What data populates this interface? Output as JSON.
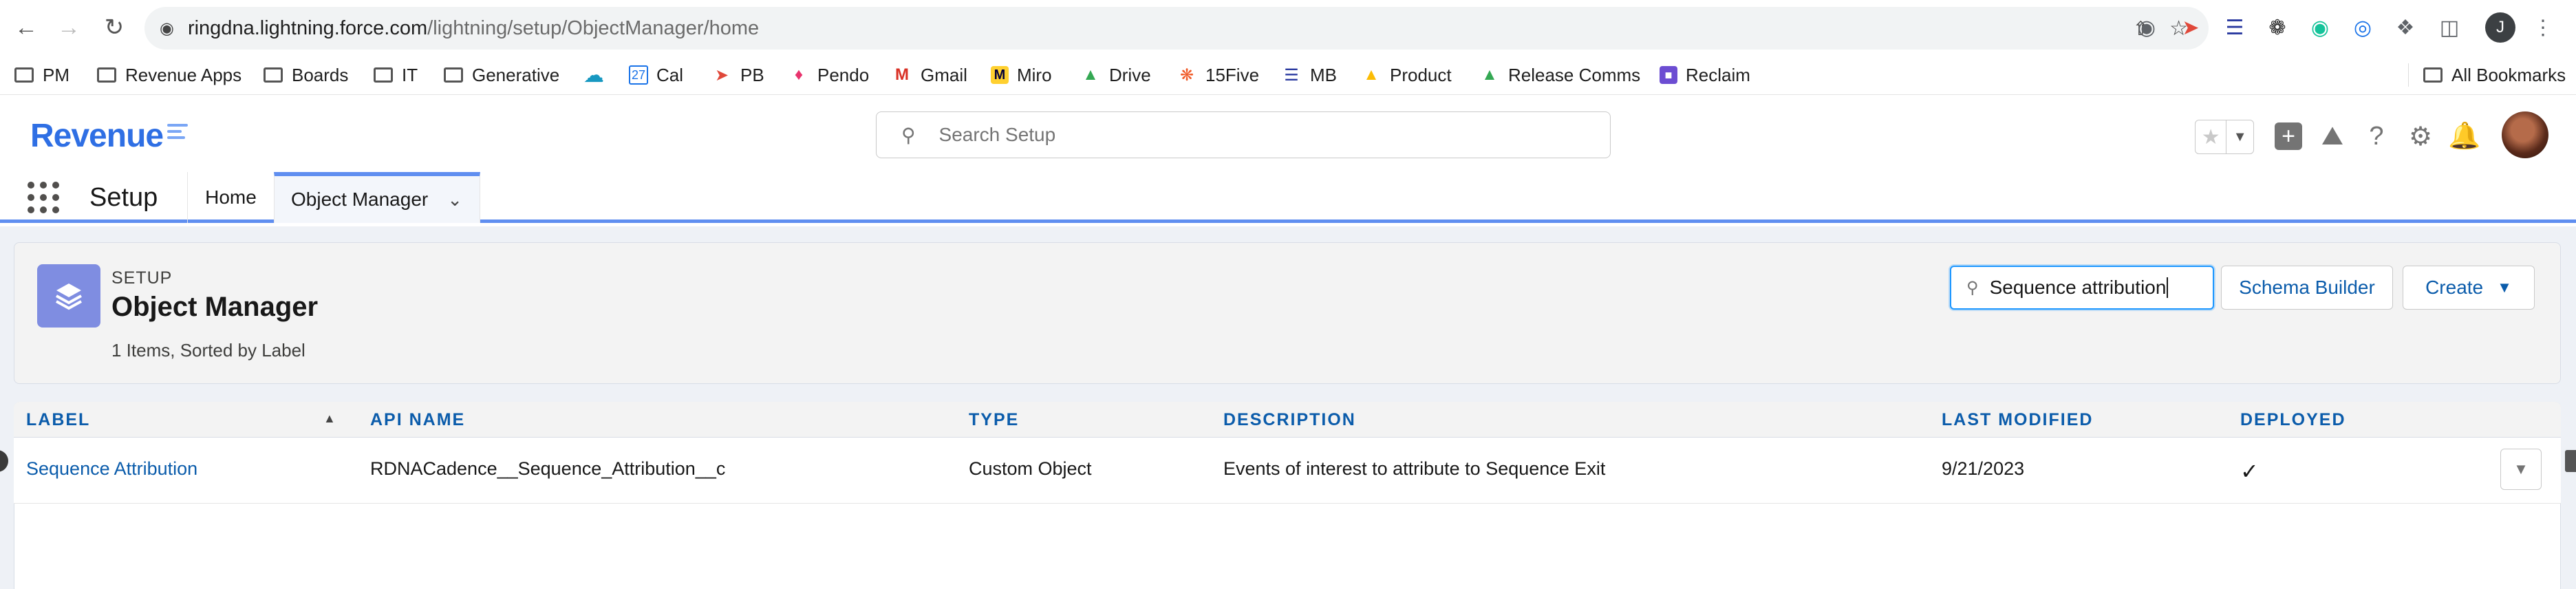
{
  "browser": {
    "url_host": "ringdna.lightning.force.com",
    "url_path": "/lightning/setup/ObjectManager/home",
    "bookmarks": [
      {
        "label": "PM",
        "icon": "folder-icon"
      },
      {
        "label": "Revenue Apps",
        "icon": "folder-icon"
      },
      {
        "label": "Boards",
        "icon": "folder-icon"
      },
      {
        "label": "IT",
        "icon": "folder-icon"
      },
      {
        "label": "Generative",
        "icon": "folder-icon"
      },
      {
        "label": "",
        "icon": "salesforce-cloud-icon"
      },
      {
        "label": "Cal",
        "icon": "calendar-icon"
      },
      {
        "label": "PB",
        "icon": "pb-icon"
      },
      {
        "label": "Pendo",
        "icon": "pendo-icon"
      },
      {
        "label": "Gmail",
        "icon": "gmail-icon"
      },
      {
        "label": "Miro",
        "icon": "miro-icon"
      },
      {
        "label": "Drive",
        "icon": "drive-icon"
      },
      {
        "label": "15Five",
        "icon": "15five-icon"
      },
      {
        "label": "MB",
        "icon": "mb-icon"
      },
      {
        "label": "Product",
        "icon": "drive-icon"
      },
      {
        "label": "Release Comms",
        "icon": "drive-icon"
      },
      {
        "label": "Reclaim",
        "icon": "reclaim-icon"
      }
    ],
    "all_bookmarks": "All Bookmarks",
    "profile_initial": "J"
  },
  "header": {
    "logo_text": "Revenue",
    "search_placeholder": "Search Setup"
  },
  "app_nav": {
    "app_name": "Setup",
    "tabs": [
      {
        "label": "Home"
      },
      {
        "label": "Object Manager"
      }
    ]
  },
  "object_manager": {
    "kicker": "SETUP",
    "title": "Object Manager",
    "count_text": "1 Items, Sorted by Label",
    "quick_find_value": "Sequence attribution",
    "schema_builder_label": "Schema Builder",
    "create_label": "Create"
  },
  "table": {
    "columns": [
      "LABEL",
      "API NAME",
      "TYPE",
      "DESCRIPTION",
      "LAST MODIFIED",
      "DEPLOYED"
    ],
    "rows": [
      {
        "label": "Sequence Attribution",
        "api_name": "RDNACadence__Sequence_Attribution__c",
        "type": "Custom Object",
        "description": "Events of interest to attribute to Sequence Exit",
        "last_modified": "9/21/2023",
        "deployed": "✓"
      }
    ]
  },
  "colors": {
    "accent": "#0b5cab",
    "brand_blue": "#2f6fe4",
    "object_icon": "#7f8de1",
    "page_bg": "#eef1f6"
  }
}
